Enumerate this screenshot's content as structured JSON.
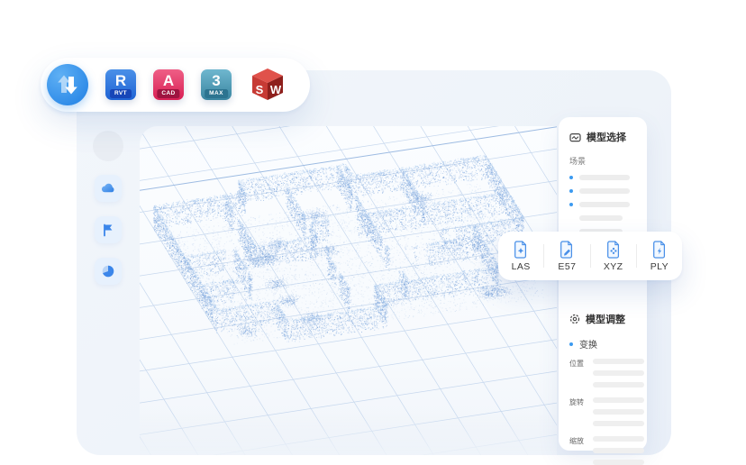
{
  "colors": {
    "accent": "#3b9af0",
    "point_cloud": "#5c8ed2",
    "point_cloud_light": "#9cc0ea",
    "grid_line": "#c7d8ee",
    "grid_line_dark": "#9dbbe2",
    "skeleton_bar": "#ededed",
    "panel_text": "#333333",
    "revit_blue": "#2f6fe0",
    "autocad_red": "#e23b66",
    "max_teal": "#4f9cb4",
    "solidworks_red": "#c23a32"
  },
  "toolbar": {
    "transfer_icon": "transfer-arrows-icon",
    "apps": [
      {
        "name": "revit",
        "letter": "R",
        "badge": "RVT"
      },
      {
        "name": "autocad",
        "letter": "A",
        "badge": "CAD"
      },
      {
        "name": "3ds-max",
        "letter": "3",
        "badge": "MAX"
      },
      {
        "name": "solidworks",
        "letter_left": "S",
        "letter_right": "W"
      }
    ]
  },
  "sidebar": {
    "icons": [
      "cloud-icon",
      "flag-icon",
      "pie-chart-icon"
    ]
  },
  "model_select_panel": {
    "icon": "screen-pulse-icon",
    "title": "模型选择",
    "section_label": "场景"
  },
  "formats": {
    "items": [
      {
        "label": "LAS",
        "icon": "sparkle-file-icon"
      },
      {
        "label": "E57",
        "icon": "pen-file-icon"
      },
      {
        "label": "XYZ",
        "icon": "scatter-file-icon"
      },
      {
        "label": "PLY",
        "icon": "bolt-file-icon"
      }
    ]
  },
  "model_adjust_panel": {
    "icon": "gear-icon",
    "title": "模型调整",
    "section_label": "变换",
    "groups": [
      {
        "label": "位置"
      },
      {
        "label": "旋转"
      },
      {
        "label": "缩放"
      }
    ]
  }
}
